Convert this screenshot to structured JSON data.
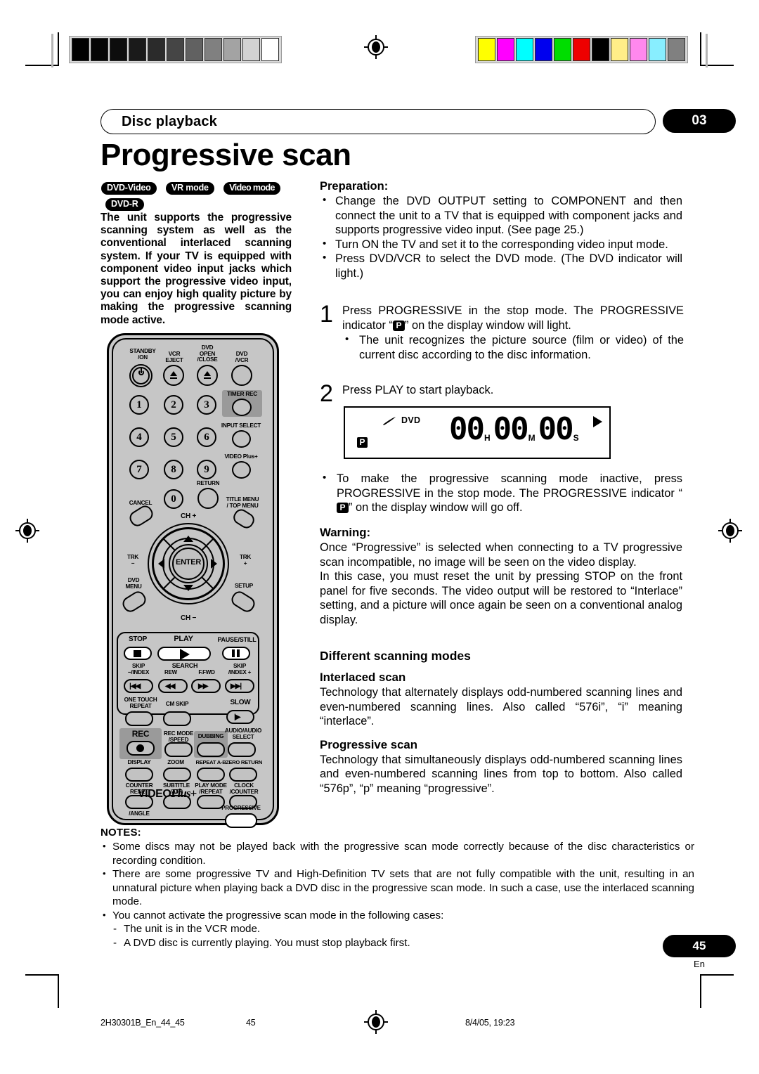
{
  "header": {
    "chapter_label": "Disc playback",
    "chapter_number": "03",
    "title": "Progressive scan"
  },
  "badges": [
    {
      "label": "DVD-Video"
    },
    {
      "label": "VR mode"
    },
    {
      "label": "Video mode"
    },
    {
      "label": "DVD-R"
    }
  ],
  "lead_paragraph": "The unit supports the progressive scanning system as well as the conventional interlaced scanning system. If your TV is equipped with component video input jacks which support the progressive video input, you can enjoy high quality picture by making the progressive scanning mode active.",
  "preparation": {
    "heading": "Preparation:",
    "items": [
      "Change the DVD OUTPUT setting to COMPONENT and then connect the unit to a TV that is equipped with component jacks and supports progressive video input. (See page 25.)",
      "Turn ON the TV and set it to the corresponding video input mode.",
      "Press DVD/VCR to select the DVD mode. (The DVD indicator will light.)"
    ]
  },
  "steps": [
    {
      "number": "1",
      "text_before": "Press PROGRESSIVE in the stop mode. The PROGRESSIVE indicator “",
      "indicator": "P",
      "text_after": "” on the display window will light.",
      "sub_bullet": "The unit recognizes the picture source (film or video) of the current disc according to the disc information."
    },
    {
      "number": "2",
      "text": "Press PLAY to start playback."
    }
  ],
  "display_window": {
    "disc_icon": "disc-icon",
    "mode_label": "DVD",
    "progressive_indicator": "P",
    "hours": "00",
    "hours_unit": "H",
    "minutes": "00",
    "minutes_unit": "M",
    "seconds": "00",
    "seconds_unit": "S",
    "play_icon": "play-triangle-icon"
  },
  "post_display_bullet": {
    "text_before": "To make the progressive scanning mode inactive, press PROGRESSIVE in the stop mode. The PROGRESSIVE indicator “",
    "indicator": "P",
    "text_after": "” on the display window will go off."
  },
  "warning": {
    "heading": "Warning:",
    "paragraph1": "Once “Progressive” is selected when connecting to a TV progressive scan incompatible, no image will be seen on the video display.",
    "paragraph2": "In this case, you must reset the unit by pressing STOP  on the front panel for five seconds. The video output will be restored to “Interlace” setting, and a picture will once again be seen on a conventional analog display."
  },
  "scanning_modes": {
    "heading": "Different scanning modes",
    "interlaced": {
      "heading": "Interlaced scan",
      "text": "Technology that alternately displays odd-numbered scanning lines and even-numbered scanning lines. Also called “576i”, “i” meaning “interlace”."
    },
    "progressive": {
      "heading": "Progressive scan",
      "text": "Technology that simultaneously displays odd-numbered scanning lines and even-numbered scanning lines from top to bottom. Also called “576p”, “p” meaning “progressive”."
    }
  },
  "notes": {
    "heading": "NOTES:",
    "items": [
      "Some discs may not be played back with the progressive scan mode correctly because of the disc characteristics or recording condition.",
      "There are some progressive TV and High-Definition TV sets that are not fully compatible with the unit, resulting in an unnatural picture when playing back a DVD disc in the progressive scan mode. In such a case, use the interlaced scanning mode.",
      "You cannot activate the progressive scan mode in the following cases:"
    ],
    "sub_items": [
      "The unit is in the VCR mode.",
      "A DVD disc is currently playing. You must stop playback first."
    ]
  },
  "footer": {
    "page_number": "45",
    "language": "En",
    "file_id": "2H30301B_En_44_45",
    "sheet_number": "45",
    "timestamp": "8/4/05, 19:23"
  },
  "calibration": {
    "grayscale": [
      "#000000",
      "#050505",
      "#0d0d0d",
      "#1a1a1a",
      "#2b2b2b",
      "#454545",
      "#616161",
      "#808080",
      "#a3a3a3",
      "#d2d2d2",
      "#ffffff"
    ],
    "color": [
      "#ffff00",
      "#ff00ff",
      "#00ffff",
      "#0000ee",
      "#00dd00",
      "#ee0000",
      "#000000",
      "#ffee88",
      "#ff88ee",
      "#88eeff",
      "#808080"
    ]
  },
  "remote": {
    "labels": {
      "standby": "STANDBY\n/ON",
      "vcr_eject": "VCR\nEJECT",
      "dvd_open_close": "DVD\nOPEN\n/CLOSE",
      "dvd_vcr": "DVD\n/VCR",
      "timer_rec": "TIMER REC",
      "input_select": "INPUT SELECT",
      "video_plus": "VIDEO Plus+",
      "return": "RETURN",
      "cancel": "CANCEL",
      "title_menu": "TITLE MENU\n/ TOP MENU",
      "ch_plus": "CH +",
      "ch_minus": "CH −",
      "trk_minus": "TRK\n−",
      "trk_plus": "TRK\n+",
      "enter": "ENTER",
      "dvd_menu": "DVD\nMENU",
      "setup": "SETUP",
      "stop": "STOP",
      "play": "PLAY",
      "pause_still": "PAUSE/STILL",
      "skip_index_minus": "SKIP\n−/INDEX",
      "search": "SEARCH",
      "rew": "REW",
      "ffwd": "F.FWD",
      "skip_index_plus": "SKIP\n/INDEX +",
      "one_touch_repeat": "ONE TOUCH\nREPEAT",
      "cm_skip": "CM SKIP",
      "slow": "SLOW",
      "rec": "REC",
      "rec_mode_speed": "REC MODE\n/SPEED",
      "dubbing": "DUBBING",
      "audio_select": "AUDIO/AUDIO\nSELECT",
      "display": "DISPLAY",
      "zoom": "ZOOM",
      "repeat_ab": "REPEAT A-B",
      "zero_return": "ZERO RETURN",
      "counter_reset": "COUNTER\nRESET",
      "subtitle_atr": "SUBTITLE\n/ATR",
      "play_mode_repeat": "PLAY MODE\n/REPEAT",
      "clock_counter": "CLOCK\n/COUNTER",
      "angle": "/ANGLE",
      "progressive": "PROGRESSIVE",
      "brand": "VIDEO",
      "brand_italic": "Plus+"
    },
    "numbers": [
      "1",
      "2",
      "3",
      "4",
      "5",
      "6",
      "7",
      "8",
      "9",
      "0"
    ]
  }
}
